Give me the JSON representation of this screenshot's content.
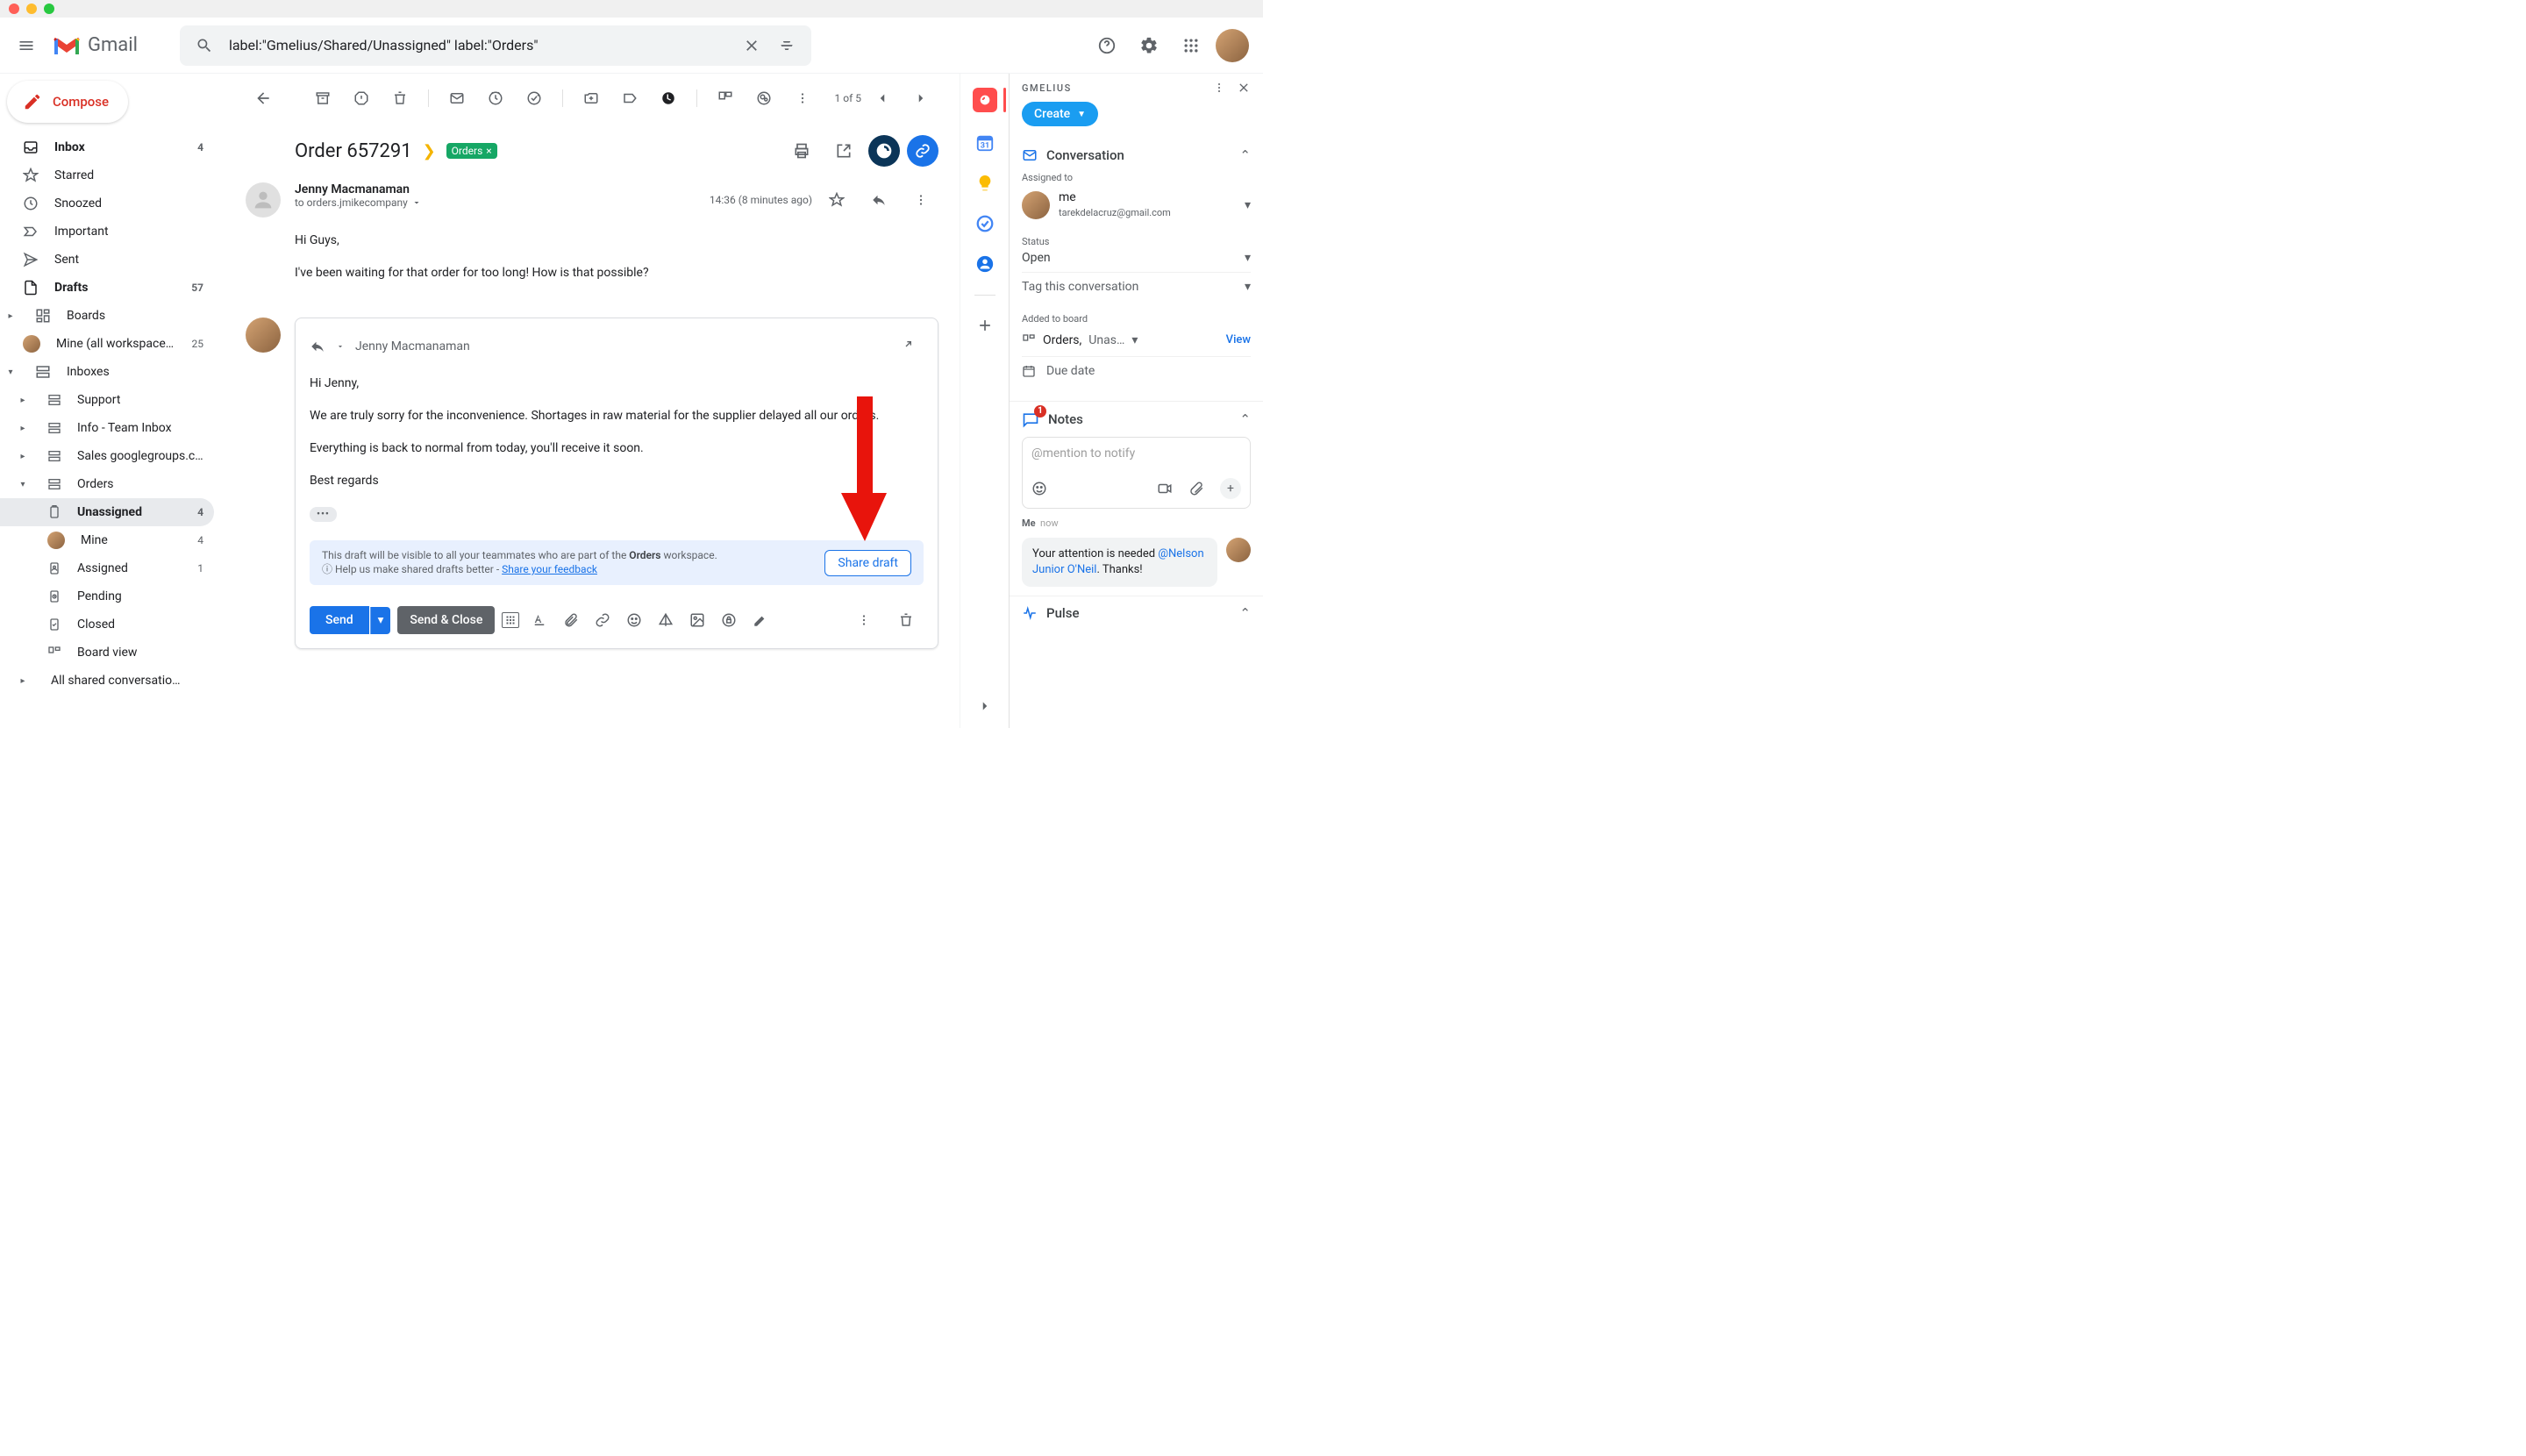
{
  "brand": "Gmail",
  "search": {
    "query": "label:\"Gmelius/Shared/Unassigned\" label:\"Orders\""
  },
  "compose_label": "Compose",
  "nav": {
    "inbox": "Inbox",
    "inbox_count": "4",
    "starred": "Starred",
    "snoozed": "Snoozed",
    "important": "Important",
    "sent": "Sent",
    "drafts": "Drafts",
    "drafts_count": "57",
    "boards": "Boards",
    "mine_ws": "Mine (all workspaces)",
    "mine_ws_count": "25",
    "inboxes": "Inboxes",
    "support": "Support",
    "info": "Info - Team Inbox",
    "sales": "Sales googlegroups.c…",
    "orders": "Orders",
    "unassigned": "Unassigned",
    "unassigned_count": "4",
    "mine": "Mine",
    "mine_count": "4",
    "assigned": "Assigned",
    "assigned_count": "1",
    "pending": "Pending",
    "closed": "Closed",
    "board_view": "Board view",
    "all_shared": "All shared conversatio…"
  },
  "pager": {
    "text": "1 of 5"
  },
  "subject": "Order 657291",
  "subject_label": "Orders",
  "message": {
    "from": "Jenny Macmanaman",
    "to": "to orders.jmikecompany",
    "time": "14:36 (8 minutes ago)",
    "body1": "Hi Guys,",
    "body2": "I've been waiting for that order for too long! How is that possible?"
  },
  "reply": {
    "to": "Jenny Macmanaman",
    "b1": "Hi Jenny,",
    "b2": "We are truly sorry for the inconvenience. Shortages in raw material for the supplier delayed all our orders.",
    "b3": "Everything is back to normal from today, you'll receive it soon.",
    "b4": "Best regards"
  },
  "banner": {
    "text1": "This draft will be visible to all your teammates who are part of the ",
    "bold": "Orders",
    "text2": " workspace.",
    "help": "Help us make shared drafts better - ",
    "link": "Share your feedback",
    "share_btn": "Share draft"
  },
  "compose_bar": {
    "send": "Send",
    "send_close": "Send & Close"
  },
  "gmelius": {
    "brand": "GMELIUS",
    "create": "Create",
    "conversation": "Conversation",
    "assigned_to": "Assigned to",
    "me": "me",
    "email": "tarekdelacruz@gmail.com",
    "status_lbl": "Status",
    "status": "Open",
    "tag": "Tag this conversation",
    "added_board": "Added to board",
    "board_name": "Orders,",
    "board_col": "Unas…",
    "view": "View",
    "due": "Due date",
    "notes": "Notes",
    "note_ph": "@mention to notify",
    "note_auth": "Me",
    "note_time": "now",
    "note_body1": "Your attention is needed ",
    "note_mention": "@Nelson Junior O'Neil",
    "note_body2": ". Thanks!",
    "pulse": "Pulse"
  }
}
